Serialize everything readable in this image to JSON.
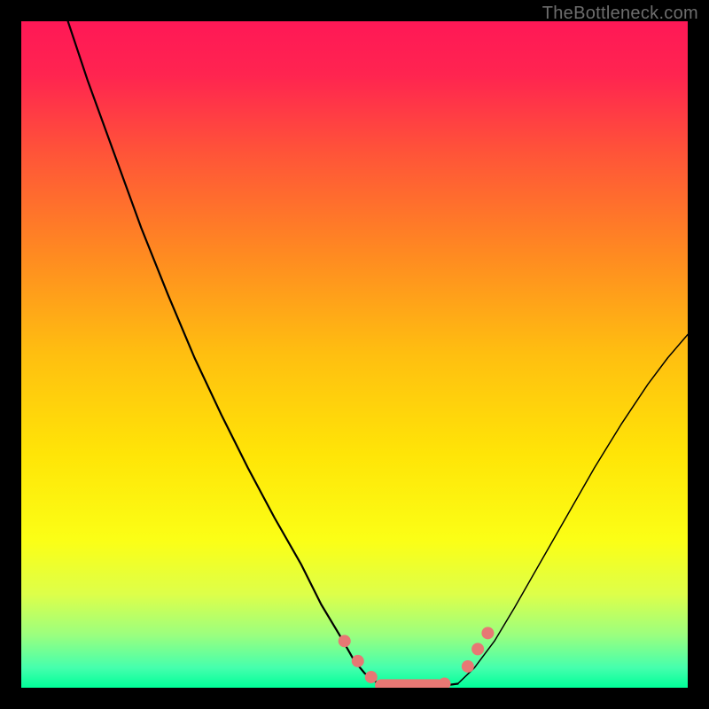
{
  "watermark": "TheBottleneck.com",
  "chart_data": {
    "type": "line",
    "title": "",
    "xlabel": "",
    "ylabel": "",
    "xlim": [
      0,
      100
    ],
    "ylim": [
      0,
      100
    ],
    "grid": false,
    "background_gradient": {
      "stops": [
        {
          "offset": 0.0,
          "color": "#ff1856"
        },
        {
          "offset": 0.08,
          "color": "#ff2450"
        },
        {
          "offset": 0.2,
          "color": "#ff5538"
        },
        {
          "offset": 0.35,
          "color": "#ff8a21"
        },
        {
          "offset": 0.5,
          "color": "#ffbf10"
        },
        {
          "offset": 0.65,
          "color": "#ffe507"
        },
        {
          "offset": 0.78,
          "color": "#fbff16"
        },
        {
          "offset": 0.86,
          "color": "#ddff4a"
        },
        {
          "offset": 0.92,
          "color": "#9cff7e"
        },
        {
          "offset": 0.97,
          "color": "#45ffad"
        },
        {
          "offset": 1.0,
          "color": "#00ff99"
        }
      ]
    },
    "series": [
      {
        "name": "left-curve",
        "stroke": "#000000",
        "stroke_width": 2.2,
        "x": [
          7.0,
          10.0,
          14.0,
          18.0,
          22.0,
          26.0,
          30.0,
          34.0,
          38.0,
          42.0,
          45.0,
          48.0,
          50.0,
          51.5,
          53.0,
          54.0
        ],
        "y": [
          100.0,
          91.0,
          80.0,
          69.0,
          59.0,
          49.5,
          41.0,
          33.0,
          25.5,
          18.5,
          12.5,
          7.5,
          4.0,
          2.2,
          1.0,
          0.5
        ]
      },
      {
        "name": "flat-bottom",
        "stroke": "#000000",
        "stroke_width": 2.2,
        "x": [
          54.0,
          56.0,
          58.0,
          60.0,
          62.0,
          64.0,
          65.5
        ],
        "y": [
          0.5,
          0.3,
          0.25,
          0.25,
          0.3,
          0.4,
          0.6
        ]
      },
      {
        "name": "right-curve",
        "stroke": "#000000",
        "stroke_width": 1.5,
        "x": [
          65.5,
          68.0,
          71.0,
          74.0,
          78.0,
          82.0,
          86.0,
          90.0,
          94.0,
          97.0,
          100.0
        ],
        "y": [
          0.6,
          3.0,
          7.0,
          12.0,
          19.0,
          26.0,
          33.0,
          39.5,
          45.5,
          49.5,
          53.0
        ]
      }
    ],
    "markers": {
      "name": "pink-markers",
      "fill": "#e77874",
      "stroke": "#e77874",
      "r": 7,
      "points": [
        {
          "x": 48.5,
          "y": 7.0
        },
        {
          "x": 50.5,
          "y": 4.0
        },
        {
          "x": 52.5,
          "y": 1.6
        },
        {
          "x": 63.5,
          "y": 0.6
        },
        {
          "x": 67.0,
          "y": 3.2
        },
        {
          "x": 68.5,
          "y": 5.8
        },
        {
          "x": 70.0,
          "y": 8.2
        }
      ],
      "capsule": {
        "x1": 54.0,
        "x2": 62.5,
        "y": 0.35,
        "r": 7
      }
    }
  }
}
